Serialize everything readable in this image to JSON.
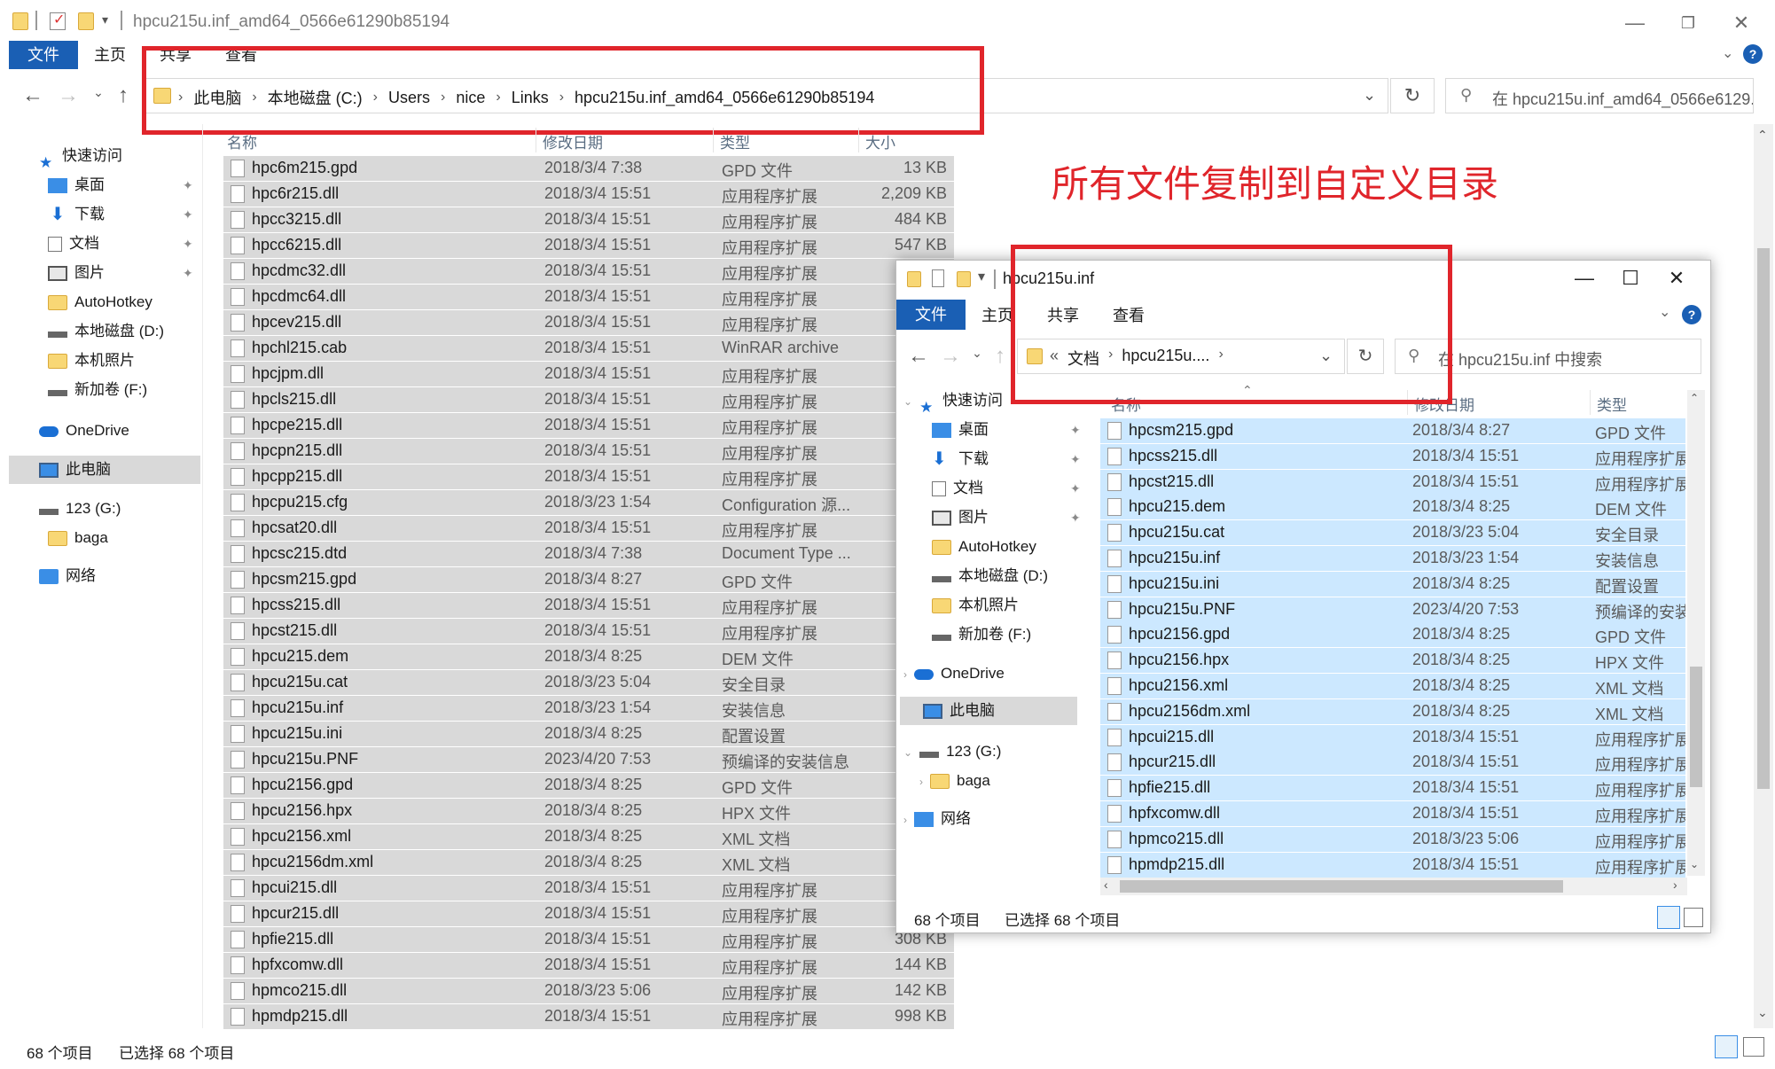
{
  "main_window": {
    "title": "hpcu215u.inf_amd64_0566e61290b85194",
    "ribbon": {
      "file": "文件",
      "tabs": [
        "主页",
        "共享",
        "查看"
      ]
    },
    "breadcrumb": [
      "此电脑",
      "本地磁盘 (C:)",
      "Users",
      "nice",
      "Links",
      "hpcu215u.inf_amd64_0566e61290b85194"
    ],
    "search_placeholder": "在 hpcu215u.inf_amd64_0566e6129...",
    "columns": {
      "name": "名称",
      "date": "修改日期",
      "type": "类型",
      "size": "大小"
    },
    "sidebar": [
      {
        "label": "快速访问",
        "icon": "star-icon",
        "pinned": false
      },
      {
        "label": "桌面",
        "icon": "desktop-icon",
        "pinned": true
      },
      {
        "label": "下载",
        "icon": "download-icon",
        "pinned": true
      },
      {
        "label": "文档",
        "icon": "document-icon",
        "pinned": true
      },
      {
        "label": "图片",
        "icon": "picture-icon",
        "pinned": true
      },
      {
        "label": "AutoHotkey",
        "icon": "folder-icon",
        "pinned": false
      },
      {
        "label": "本地磁盘 (D:)",
        "icon": "drive-icon",
        "pinned": false
      },
      {
        "label": "本机照片",
        "icon": "folder-icon",
        "pinned": false
      },
      {
        "label": "新加卷 (F:)",
        "icon": "drive-icon",
        "pinned": false
      },
      {
        "label": "OneDrive",
        "icon": "cloud-icon",
        "pinned": false
      },
      {
        "label": "此电脑",
        "icon": "computer-icon",
        "pinned": false,
        "selected": true
      },
      {
        "label": "123 (G:)",
        "icon": "drive-icon",
        "pinned": false
      },
      {
        "label": "baga",
        "icon": "folder-icon",
        "pinned": false
      },
      {
        "label": "网络",
        "icon": "network-icon",
        "pinned": false
      }
    ],
    "files": [
      {
        "name": "hpc6m215.gpd",
        "date": "2018/3/4 7:38",
        "type": "GPD 文件",
        "size": "13 KB"
      },
      {
        "name": "hpc6r215.dll",
        "date": "2018/3/4 15:51",
        "type": "应用程序扩展",
        "size": "2,209 KB"
      },
      {
        "name": "hpcc3215.dll",
        "date": "2018/3/4 15:51",
        "type": "应用程序扩展",
        "size": "484 KB"
      },
      {
        "name": "hpcc6215.dll",
        "date": "2018/3/4 15:51",
        "type": "应用程序扩展",
        "size": "547 KB"
      },
      {
        "name": "hpcdmc32.dll",
        "date": "2018/3/4 15:51",
        "type": "应用程序扩展",
        "size": ""
      },
      {
        "name": "hpcdmc64.dll",
        "date": "2018/3/4 15:51",
        "type": "应用程序扩展",
        "size": ""
      },
      {
        "name": "hpcev215.dll",
        "date": "2018/3/4 15:51",
        "type": "应用程序扩展",
        "size": ""
      },
      {
        "name": "hpchl215.cab",
        "date": "2018/3/4 15:51",
        "type": "WinRAR archive",
        "size": ""
      },
      {
        "name": "hpcjpm.dll",
        "date": "2018/3/4 15:51",
        "type": "应用程序扩展",
        "size": ""
      },
      {
        "name": "hpcls215.dll",
        "date": "2018/3/4 15:51",
        "type": "应用程序扩展",
        "size": ""
      },
      {
        "name": "hpcpe215.dll",
        "date": "2018/3/4 15:51",
        "type": "应用程序扩展",
        "size": ""
      },
      {
        "name": "hpcpn215.dll",
        "date": "2018/3/4 15:51",
        "type": "应用程序扩展",
        "size": ""
      },
      {
        "name": "hpcpp215.dll",
        "date": "2018/3/4 15:51",
        "type": "应用程序扩展",
        "size": ""
      },
      {
        "name": "hpcpu215.cfg",
        "date": "2018/3/23 1:54",
        "type": "Configuration 源...",
        "size": ""
      },
      {
        "name": "hpcsat20.dll",
        "date": "2018/3/4 15:51",
        "type": "应用程序扩展",
        "size": ""
      },
      {
        "name": "hpcsc215.dtd",
        "date": "2018/3/4 7:38",
        "type": "Document Type ...",
        "size": ""
      },
      {
        "name": "hpcsm215.gpd",
        "date": "2018/3/4 8:27",
        "type": "GPD 文件",
        "size": ""
      },
      {
        "name": "hpcss215.dll",
        "date": "2018/3/4 15:51",
        "type": "应用程序扩展",
        "size": ""
      },
      {
        "name": "hpcst215.dll",
        "date": "2018/3/4 15:51",
        "type": "应用程序扩展",
        "size": ""
      },
      {
        "name": "hpcu215.dem",
        "date": "2018/3/4 8:25",
        "type": "DEM 文件",
        "size": ""
      },
      {
        "name": "hpcu215u.cat",
        "date": "2018/3/23 5:04",
        "type": "安全目录",
        "size": ""
      },
      {
        "name": "hpcu215u.inf",
        "date": "2018/3/23 1:54",
        "type": "安装信息",
        "size": ""
      },
      {
        "name": "hpcu215u.ini",
        "date": "2018/3/4 8:25",
        "type": "配置设置",
        "size": ""
      },
      {
        "name": "hpcu215u.PNF",
        "date": "2023/4/20 7:53",
        "type": "预编译的安装信息",
        "size": ""
      },
      {
        "name": "hpcu2156.gpd",
        "date": "2018/3/4 8:25",
        "type": "GPD 文件",
        "size": ""
      },
      {
        "name": "hpcu2156.hpx",
        "date": "2018/3/4 8:25",
        "type": "HPX 文件",
        "size": ""
      },
      {
        "name": "hpcu2156.xml",
        "date": "2018/3/4 8:25",
        "type": "XML 文档",
        "size": ""
      },
      {
        "name": "hpcu2156dm.xml",
        "date": "2018/3/4 8:25",
        "type": "XML 文档",
        "size": ""
      },
      {
        "name": "hpcui215.dll",
        "date": "2018/3/4 15:51",
        "type": "应用程序扩展",
        "size": ""
      },
      {
        "name": "hpcur215.dll",
        "date": "2018/3/4 15:51",
        "type": "应用程序扩展",
        "size": ""
      },
      {
        "name": "hpfie215.dll",
        "date": "2018/3/4 15:51",
        "type": "应用程序扩展",
        "size": "308 KB"
      },
      {
        "name": "hpfxcomw.dll",
        "date": "2018/3/4 15:51",
        "type": "应用程序扩展",
        "size": "144 KB"
      },
      {
        "name": "hpmco215.dll",
        "date": "2018/3/23 5:06",
        "type": "应用程序扩展",
        "size": "142 KB"
      },
      {
        "name": "hpmdp215.dll",
        "date": "2018/3/4 15:51",
        "type": "应用程序扩展",
        "size": "998 KB"
      }
    ],
    "status": {
      "count": "68 个项目",
      "selected": "已选择 68 个项目"
    }
  },
  "annotation": {
    "text": "所有文件复制到自定义目录",
    "color": "#e0252b"
  },
  "second_window": {
    "title": "hpcu215u.inf",
    "ribbon": {
      "file": "文件",
      "tabs": [
        "主页",
        "共享",
        "查看"
      ]
    },
    "breadcrumb": [
      "«",
      "文档",
      "hpcu215u...."
    ],
    "search_placeholder": "在 hpcu215u.inf 中搜索",
    "columns": {
      "name": "名称",
      "date": "修改日期",
      "type": "类型"
    },
    "sidebar": [
      {
        "label": "快速访问",
        "icon": "star-icon",
        "pinned": false
      },
      {
        "label": "桌面",
        "icon": "desktop-icon",
        "pinned": true
      },
      {
        "label": "下载",
        "icon": "download-icon",
        "pinned": true
      },
      {
        "label": "文档",
        "icon": "document-icon",
        "pinned": true
      },
      {
        "label": "图片",
        "icon": "picture-icon",
        "pinned": true
      },
      {
        "label": "AutoHotkey",
        "icon": "folder-icon",
        "pinned": false
      },
      {
        "label": "本地磁盘 (D:)",
        "icon": "drive-icon",
        "pinned": false
      },
      {
        "label": "本机照片",
        "icon": "folder-icon",
        "pinned": false
      },
      {
        "label": "新加卷 (F:)",
        "icon": "drive-icon",
        "pinned": false
      },
      {
        "label": "OneDrive",
        "icon": "cloud-icon",
        "pinned": false
      },
      {
        "label": "此电脑",
        "icon": "computer-icon",
        "pinned": false,
        "selected": true
      },
      {
        "label": "123 (G:)",
        "icon": "drive-icon",
        "pinned": false
      },
      {
        "label": "baga",
        "icon": "folder-icon",
        "pinned": false
      },
      {
        "label": "网络",
        "icon": "network-icon",
        "pinned": false
      }
    ],
    "files": [
      {
        "name": "hpcsm215.gpd",
        "date": "2018/3/4 8:27",
        "type": "GPD 文件"
      },
      {
        "name": "hpcss215.dll",
        "date": "2018/3/4 15:51",
        "type": "应用程序扩展"
      },
      {
        "name": "hpcst215.dll",
        "date": "2018/3/4 15:51",
        "type": "应用程序扩展"
      },
      {
        "name": "hpcu215.dem",
        "date": "2018/3/4 8:25",
        "type": "DEM 文件"
      },
      {
        "name": "hpcu215u.cat",
        "date": "2018/3/23 5:04",
        "type": "安全目录"
      },
      {
        "name": "hpcu215u.inf",
        "date": "2018/3/23 1:54",
        "type": "安装信息"
      },
      {
        "name": "hpcu215u.ini",
        "date": "2018/3/4 8:25",
        "type": "配置设置"
      },
      {
        "name": "hpcu215u.PNF",
        "date": "2023/4/20 7:53",
        "type": "预编译的安装信息"
      },
      {
        "name": "hpcu2156.gpd",
        "date": "2018/3/4 8:25",
        "type": "GPD 文件"
      },
      {
        "name": "hpcu2156.hpx",
        "date": "2018/3/4 8:25",
        "type": "HPX 文件"
      },
      {
        "name": "hpcu2156.xml",
        "date": "2018/3/4 8:25",
        "type": "XML 文档"
      },
      {
        "name": "hpcu2156dm.xml",
        "date": "2018/3/4 8:25",
        "type": "XML 文档"
      },
      {
        "name": "hpcui215.dll",
        "date": "2018/3/4 15:51",
        "type": "应用程序扩展"
      },
      {
        "name": "hpcur215.dll",
        "date": "2018/3/4 15:51",
        "type": "应用程序扩展"
      },
      {
        "name": "hpfie215.dll",
        "date": "2018/3/4 15:51",
        "type": "应用程序扩展"
      },
      {
        "name": "hpfxcomw.dll",
        "date": "2018/3/4 15:51",
        "type": "应用程序扩展"
      },
      {
        "name": "hpmco215.dll",
        "date": "2018/3/23 5:06",
        "type": "应用程序扩展"
      },
      {
        "name": "hpmdp215.dll",
        "date": "2018/3/4 15:51",
        "type": "应用程序扩展"
      }
    ],
    "status": {
      "count": "68 个项目",
      "selected": "已选择 68 个项目"
    }
  }
}
